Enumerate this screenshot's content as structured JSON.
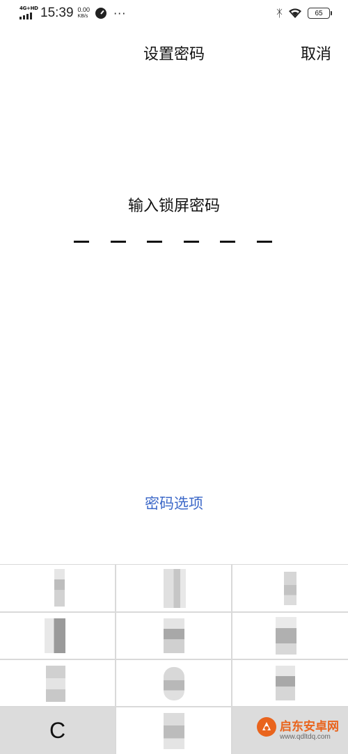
{
  "status_bar": {
    "network": "4G+HD",
    "time": "15:39",
    "speed_value": "0.00",
    "speed_unit": "KB/s",
    "more": "···",
    "battery": "65"
  },
  "header": {
    "title": "设置密码",
    "cancel_label": "取消"
  },
  "prompt": "输入锁屏密码",
  "pin_length": 6,
  "options_label": "密码选项",
  "keypad": {
    "clear_label": "C"
  },
  "watermark": {
    "name": "启东安卓网",
    "url": "www.qdltdq.com",
    "accent": "#e9641d"
  },
  "colors": {
    "link": "#3c68c8",
    "keypad_bg": "#d9d9d9"
  }
}
